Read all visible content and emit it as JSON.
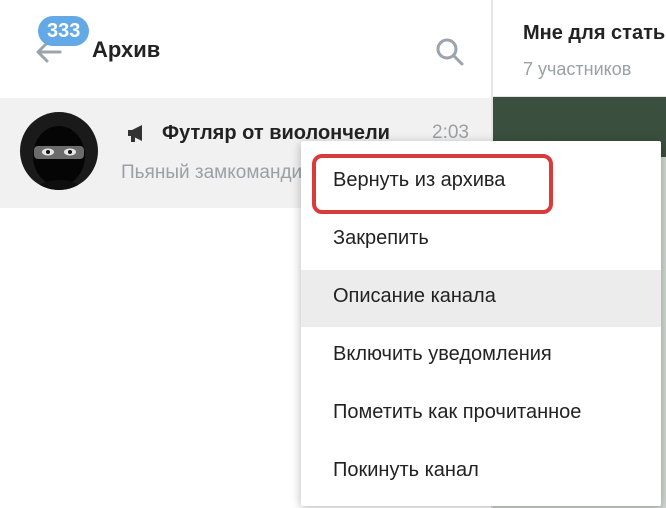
{
  "header": {
    "badge_count": "333",
    "title": "Архив",
    "icons": {
      "back": "arrow-left-icon",
      "search": "search-icon"
    }
  },
  "chat": {
    "name": "Футляр от виолончели",
    "time": "2:03",
    "preview": "Пьяный замкомандира",
    "icon": "megaphone-icon"
  },
  "right_pane": {
    "title": "Мне для статьи",
    "subtitle": "7 участников"
  },
  "context_menu": {
    "items": [
      {
        "label": "Вернуть из архива"
      },
      {
        "label": "Закрепить"
      },
      {
        "label": "Описание канала"
      },
      {
        "label": "Включить уведомления"
      },
      {
        "label": "Пометить как прочитанное"
      },
      {
        "label": "Покинуть канал"
      }
    ],
    "hovered_index": 2,
    "highlighted_index": 0
  },
  "colors": {
    "badge": "#62a9e6",
    "highlight": "#d93a3a",
    "chat_row_bg": "#f1f1f1",
    "text": "#222222",
    "muted": "#9aa0a6"
  }
}
